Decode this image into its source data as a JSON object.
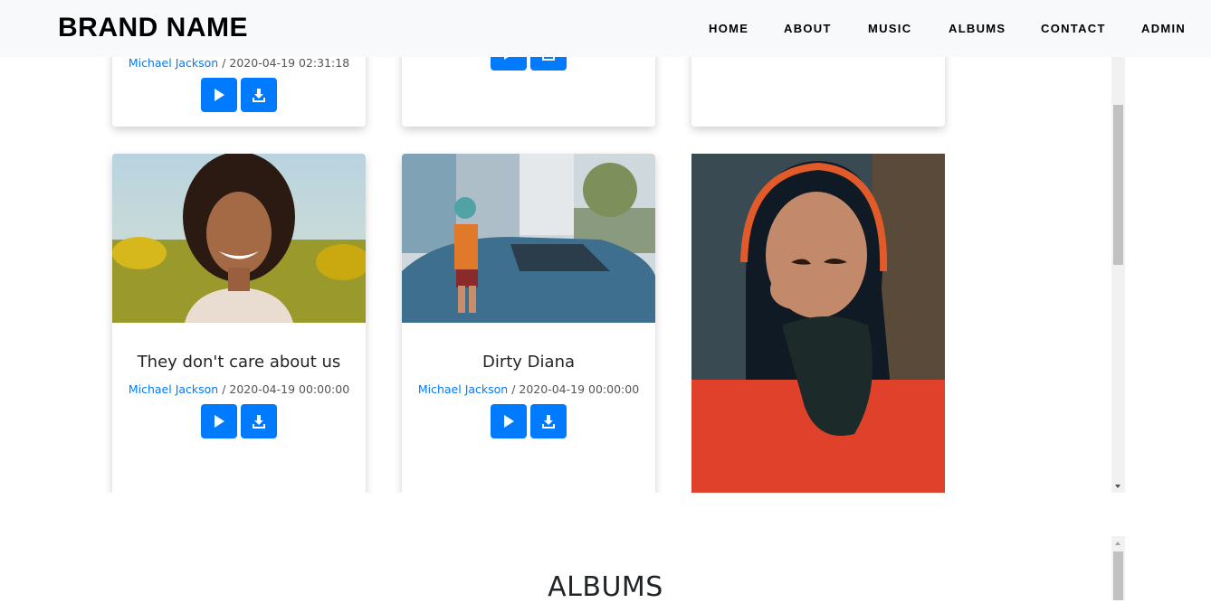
{
  "navbar": {
    "brand": "BRAND NAME",
    "links": [
      "HOME",
      "ABOUT",
      "MUSIC",
      "ALBUMS",
      "CONTACT",
      "ADMIN"
    ]
  },
  "songs_top": [
    {
      "artist": "Michael Jackson",
      "meta": " / 2020-04-19 02:31:18"
    }
  ],
  "songs": [
    {
      "title": "They don't care about us",
      "artist": "Michael Jackson",
      "meta": " / 2020-04-19 00:00:00"
    },
    {
      "title": "Dirty Diana",
      "artist": "Michael Jackson",
      "meta": " / 2020-04-19 00:00:00"
    }
  ],
  "albums_section": {
    "title": "ALBUMS"
  },
  "colors": {
    "primary": "#007bff",
    "navbar_bg": "#f8f9fa"
  },
  "icons": [
    "play-icon",
    "download-icon"
  ]
}
